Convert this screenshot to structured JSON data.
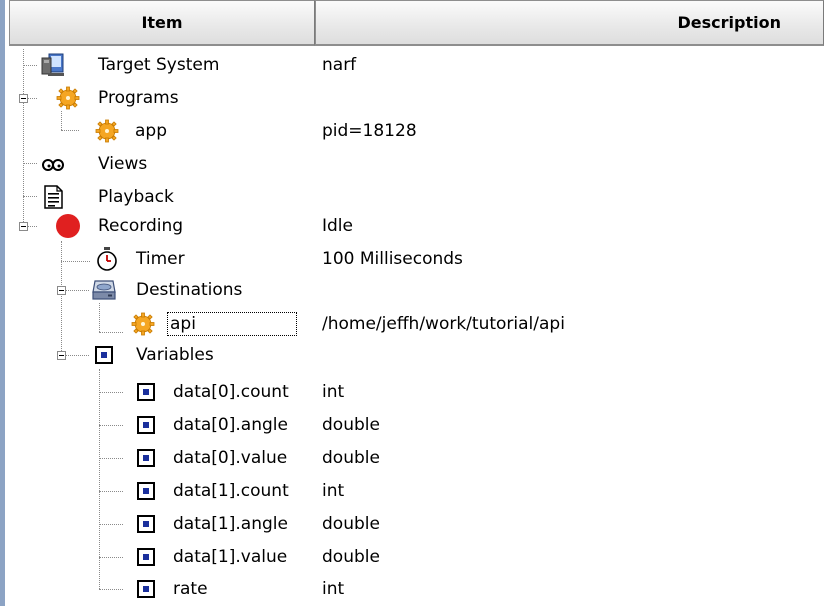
{
  "header": {
    "item_label": "Item",
    "description_label": "Description"
  },
  "rows": [
    {
      "label": "Target System",
      "desc": "narf",
      "icon": "computer-icon"
    },
    {
      "label": "Programs",
      "desc": "",
      "icon": "gear-icon"
    },
    {
      "label": "app",
      "desc": "pid=18128",
      "icon": "gear-icon"
    },
    {
      "label": "Views",
      "desc": "",
      "icon": "glasses-icon"
    },
    {
      "label": "Playback",
      "desc": "",
      "icon": "document-icon"
    },
    {
      "label": "Recording",
      "desc": "Idle",
      "icon": "record-dot-icon"
    },
    {
      "label": "Timer",
      "desc": "100 Milliseconds",
      "icon": "stopwatch-icon"
    },
    {
      "label": "Destinations",
      "desc": "",
      "icon": "drive-icon"
    },
    {
      "label": "api",
      "desc": "/home/jeffh/work/tutorial/api",
      "icon": "gear-icon"
    },
    {
      "label": "Variables",
      "desc": "",
      "icon": "variable-icon"
    },
    {
      "label": "data[0].count",
      "desc": "int",
      "icon": "variable-icon"
    },
    {
      "label": "data[0].angle",
      "desc": "double",
      "icon": "variable-icon"
    },
    {
      "label": "data[0].value",
      "desc": "double",
      "icon": "variable-icon"
    },
    {
      "label": "data[1].count",
      "desc": "int",
      "icon": "variable-icon"
    },
    {
      "label": "data[1].angle",
      "desc": "double",
      "icon": "variable-icon"
    },
    {
      "label": "data[1].value",
      "desc": "double",
      "icon": "variable-icon"
    },
    {
      "label": "rate",
      "desc": "int",
      "icon": "variable-icon"
    }
  ],
  "colors": {
    "record": "#e02020",
    "gear": "#f5a623",
    "variable_fill": "#1a2f9c"
  }
}
